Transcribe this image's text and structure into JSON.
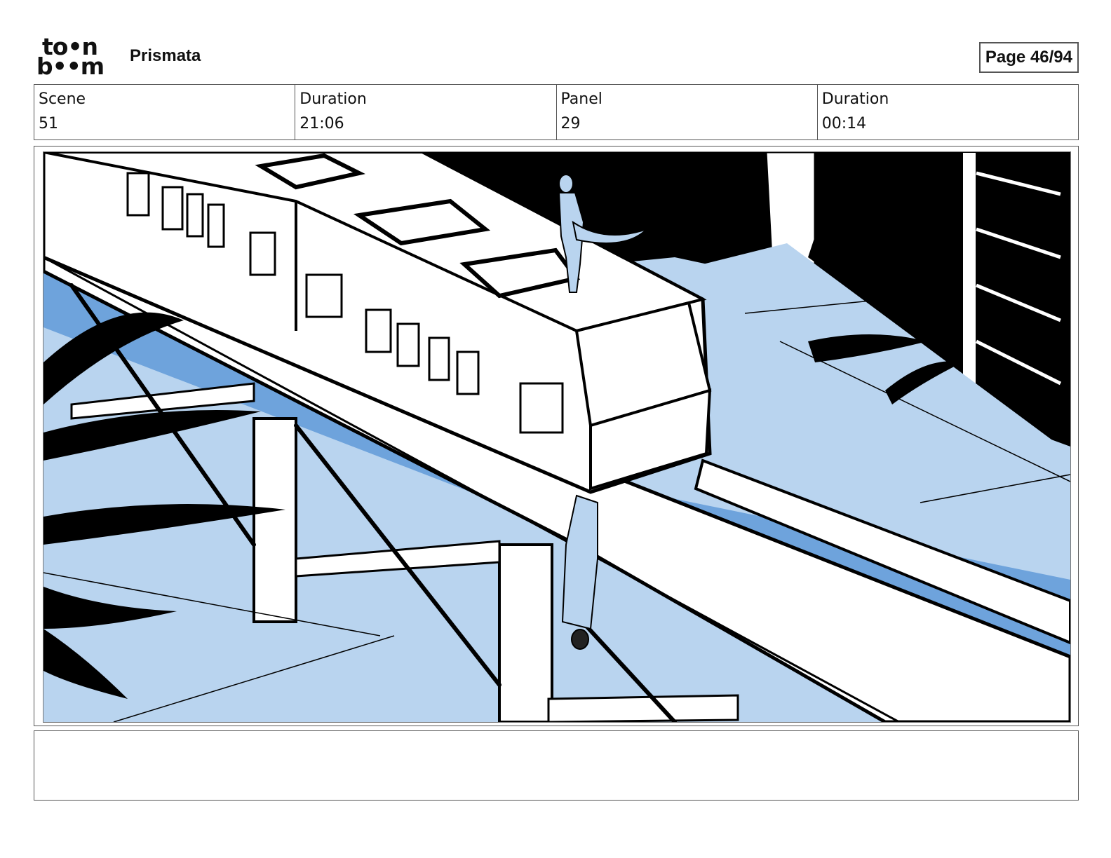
{
  "header": {
    "logo_line1": "to•n",
    "logo_line2": "b••m",
    "project_name": "Prismata",
    "page_label": "Page 46/94"
  },
  "info": [
    {
      "label": "Scene",
      "value": "51"
    },
    {
      "label": "Duration",
      "value": "21:06"
    },
    {
      "label": "Panel",
      "value": "29"
    },
    {
      "label": "Duration",
      "value": "00:14"
    }
  ],
  "panel": {
    "subject": "monorail-scene-sketch",
    "colors": {
      "ink": "#000000",
      "light-blue": "#b9d4ef",
      "mid-blue": "#6ea3dc",
      "paper": "#ffffff"
    }
  },
  "notes": {
    "text": ""
  }
}
